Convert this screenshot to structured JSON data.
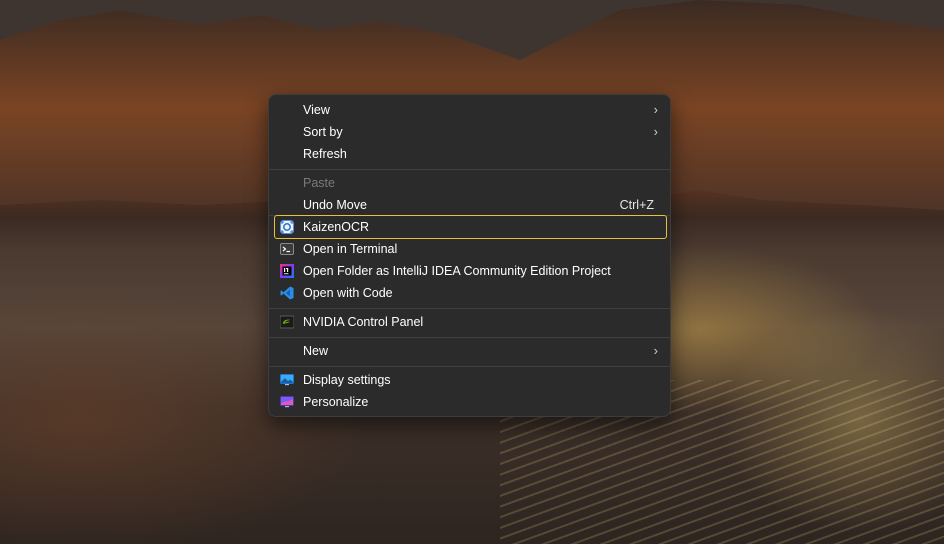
{
  "context_menu": {
    "items": [
      {
        "label": "View",
        "submenu": true
      },
      {
        "label": "Sort by",
        "submenu": true
      },
      {
        "label": "Refresh"
      },
      {
        "label": "Paste",
        "disabled": true
      },
      {
        "label": "Undo Move",
        "shortcut": "Ctrl+Z"
      },
      {
        "label": "KaizenOCR",
        "icon": "kaizenocr-icon",
        "focused": true
      },
      {
        "label": "Open in Terminal",
        "icon": "terminal-icon"
      },
      {
        "label": "Open Folder as IntelliJ IDEA Community Edition Project",
        "icon": "intellij-icon"
      },
      {
        "label": "Open with Code",
        "icon": "vscode-icon"
      },
      {
        "label": "NVIDIA Control Panel",
        "icon": "nvidia-icon"
      },
      {
        "label": "New",
        "submenu": true
      },
      {
        "label": "Display settings",
        "icon": "display-settings-icon"
      },
      {
        "label": "Personalize",
        "icon": "personalize-icon"
      }
    ],
    "chevron": "›"
  },
  "colors": {
    "menu_background": "#2b2b2b",
    "focus_outline": "#e6c23a",
    "text": "#ffffff",
    "disabled_text": "#7a7a7a"
  }
}
